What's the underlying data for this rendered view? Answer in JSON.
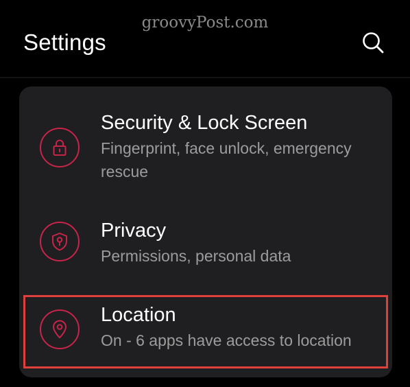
{
  "watermark": "groovyPost.com",
  "header": {
    "title": "Settings",
    "search_icon": "search-icon"
  },
  "colors": {
    "background": "#000000",
    "card": "#1f1f21",
    "accent": "#c8244a",
    "highlight_box": "#e0403c",
    "subtitle": "#9c9c9c"
  },
  "items": [
    {
      "title": "Security & Lock Screen",
      "subtitle": "Fingerprint, face unlock, emergency rescue",
      "icon": "lock-icon"
    },
    {
      "title": "Privacy",
      "subtitle": "Permissions, personal data",
      "icon": "shield-lock-icon"
    },
    {
      "title": "Location",
      "subtitle": "On - 6 apps have access to location",
      "icon": "location-pin-icon",
      "highlighted": true
    }
  ]
}
